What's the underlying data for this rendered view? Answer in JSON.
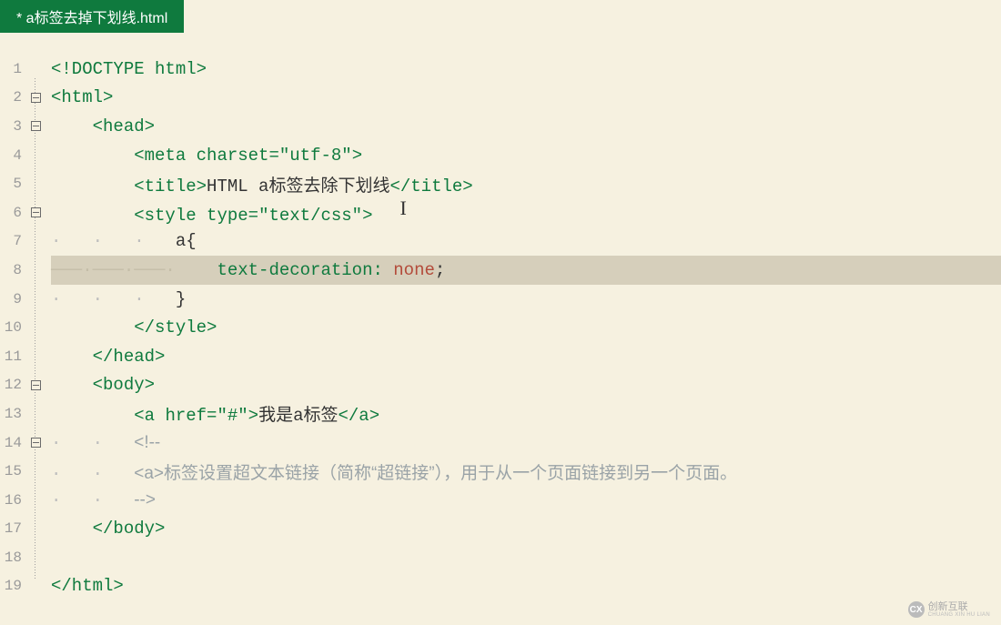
{
  "tab": {
    "title": "* a标签去掉下划线.html"
  },
  "highlighted_line": 8,
  "lines": [
    {
      "num": 1,
      "fold": false,
      "tokens": [
        {
          "cls": "tag",
          "t": "<!DOCTYPE html>"
        }
      ]
    },
    {
      "num": 2,
      "fold": true,
      "tokens": [
        {
          "cls": "tag",
          "t": "<html>"
        }
      ]
    },
    {
      "num": 3,
      "fold": true,
      "indent": 1,
      "tokens": [
        {
          "cls": "tag",
          "t": "<head>"
        }
      ]
    },
    {
      "num": 4,
      "fold": false,
      "indent": 2,
      "tokens": [
        {
          "cls": "tag",
          "t": "<meta "
        },
        {
          "cls": "attr",
          "t": "charset="
        },
        {
          "cls": "str",
          "t": "\"utf-8\""
        },
        {
          "cls": "tag",
          "t": ">"
        }
      ]
    },
    {
      "num": 5,
      "fold": false,
      "indent": 2,
      "tokens": [
        {
          "cls": "tag",
          "t": "<title>"
        },
        {
          "cls": "",
          "t": "HTML a标签去除下划线"
        },
        {
          "cls": "tag",
          "t": "</title>"
        }
      ]
    },
    {
      "num": 6,
      "fold": true,
      "indent": 2,
      "tokens": [
        {
          "cls": "tag",
          "t": "<style "
        },
        {
          "cls": "attr",
          "t": "type="
        },
        {
          "cls": "str",
          "t": "\"text/css\""
        },
        {
          "cls": "tag",
          "t": ">"
        }
      ],
      "cursor": true
    },
    {
      "num": 7,
      "fold": false,
      "indent": 3,
      "dots": true,
      "tokens": [
        {
          "cls": "",
          "t": "a{"
        }
      ]
    },
    {
      "num": 8,
      "fold": false,
      "indent": 4,
      "dash": true,
      "tokens": [
        {
          "cls": "prop",
          "t": "text-decoration: "
        },
        {
          "cls": "val",
          "t": "none"
        },
        {
          "cls": "",
          "t": ";"
        }
      ]
    },
    {
      "num": 9,
      "fold": false,
      "indent": 3,
      "dots": true,
      "tokens": [
        {
          "cls": "",
          "t": "}"
        }
      ]
    },
    {
      "num": 10,
      "fold": false,
      "indent": 2,
      "tokens": [
        {
          "cls": "tag",
          "t": "</style>"
        }
      ]
    },
    {
      "num": 11,
      "fold": false,
      "indent": 1,
      "tokens": [
        {
          "cls": "tag",
          "t": "</head>"
        }
      ]
    },
    {
      "num": 12,
      "fold": true,
      "indent": 1,
      "tokens": [
        {
          "cls": "tag",
          "t": "<body>"
        }
      ]
    },
    {
      "num": 13,
      "fold": false,
      "indent": 2,
      "tokens": [
        {
          "cls": "tag",
          "t": "<a "
        },
        {
          "cls": "attr",
          "t": "href="
        },
        {
          "cls": "str",
          "t": "\"#\""
        },
        {
          "cls": "tag",
          "t": ">"
        },
        {
          "cls": "",
          "t": "我是a标签"
        },
        {
          "cls": "tag",
          "t": "</a>"
        }
      ]
    },
    {
      "num": 14,
      "fold": true,
      "indent": 2,
      "dots2": true,
      "tokens": [
        {
          "cls": "comment",
          "t": "<!--"
        }
      ]
    },
    {
      "num": 15,
      "fold": false,
      "indent": 2,
      "dots2": true,
      "tokens": [
        {
          "cls": "comment",
          "t": "<a>标签设置超文本链接（简称“超链接”），用于从一个页面链接到另一个页面。"
        }
      ]
    },
    {
      "num": 16,
      "fold": false,
      "indent": 2,
      "dots2": true,
      "tokens": [
        {
          "cls": "comment",
          "t": "-->"
        }
      ]
    },
    {
      "num": 17,
      "fold": false,
      "indent": 1,
      "tokens": [
        {
          "cls": "tag",
          "t": "</body>"
        }
      ]
    },
    {
      "num": 18,
      "fold": false,
      "tokens": []
    },
    {
      "num": 19,
      "fold": false,
      "tokens": [
        {
          "cls": "tag",
          "t": "</html>"
        }
      ]
    }
  ],
  "watermark": {
    "icon": "CX",
    "text": "创新互联",
    "sub": "CHUANG XIN HU LIAN"
  }
}
